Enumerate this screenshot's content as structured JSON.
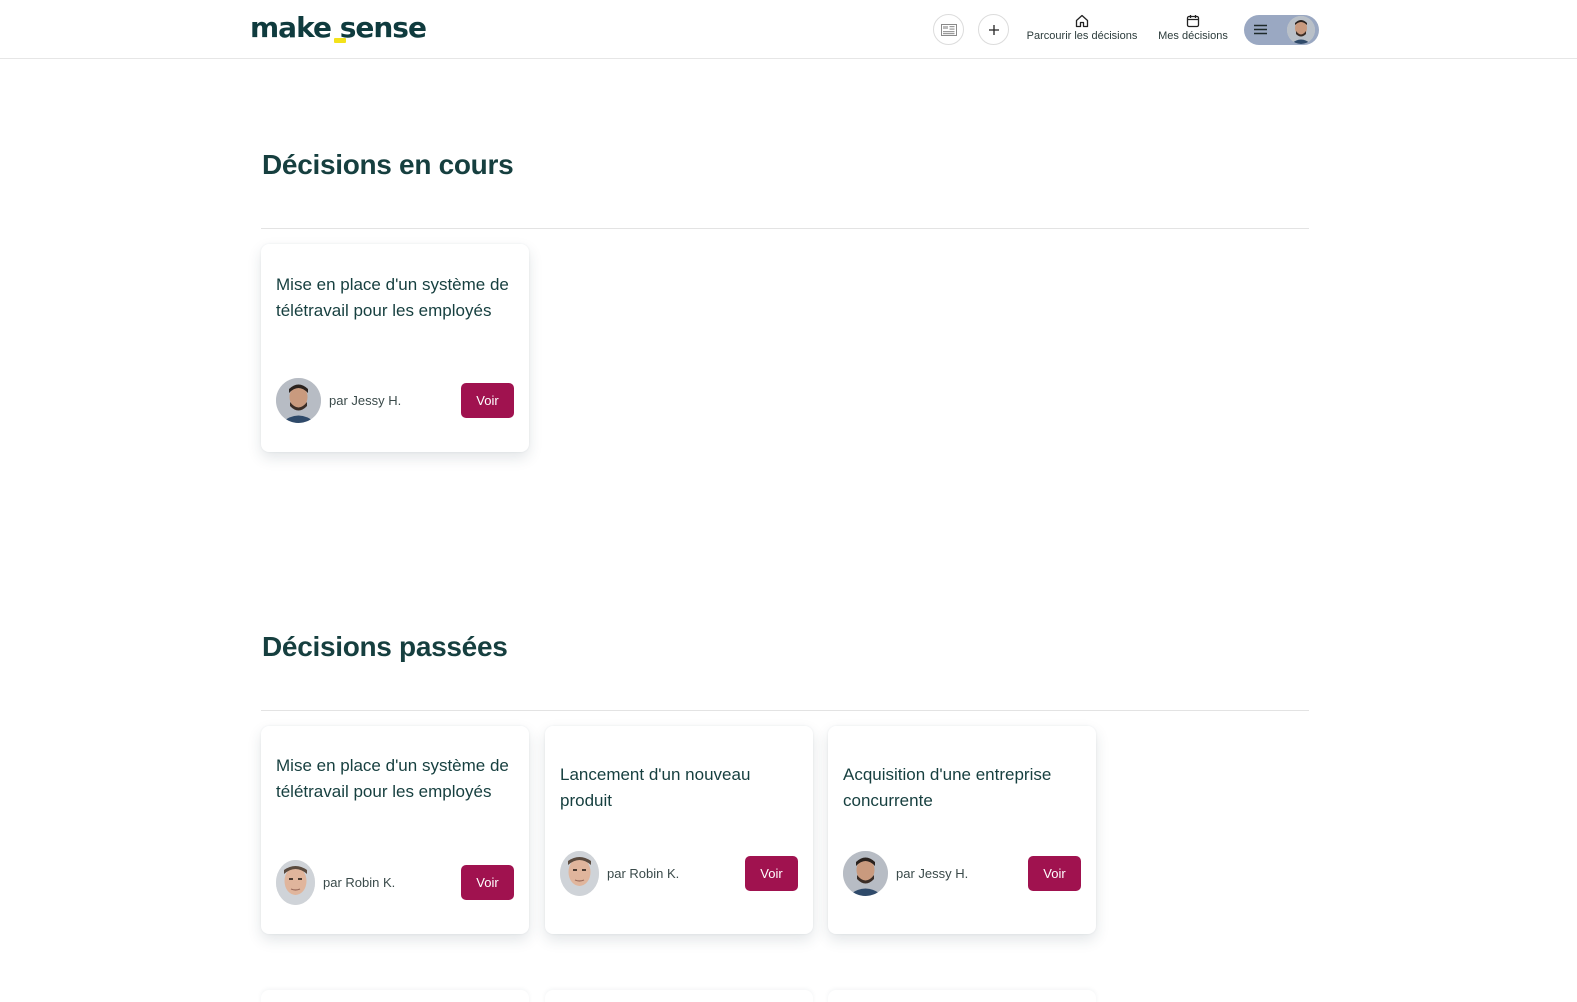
{
  "header": {
    "logo_part1": "make",
    "logo_part2": "sense",
    "browse_label": "Parcourir les décisions",
    "mine_label": "Mes décisions"
  },
  "icons": {
    "language": "language-icon",
    "add": "plus-icon",
    "home": "home-icon",
    "calendar": "calendar-icon",
    "menu": "hamburger-icon",
    "avatar": "user-avatar"
  },
  "colors": {
    "brand_dark": "#163f3f",
    "accent_button": "#a0124f",
    "logo_dot": "#f3e21b",
    "user_menu_bg": "#9aa8c2"
  },
  "sections": {
    "current_title": "Décisions en cours",
    "past_title": "Décisions passées"
  },
  "current_decisions": [
    {
      "title": "Mise en place d'un système de télétravail pour les employés",
      "author": "par Jessy H.",
      "button": "Voir"
    }
  ],
  "past_decisions": [
    {
      "title": "Mise en place d'un système de télétravail pour les employés",
      "author": "par Robin K.",
      "button": "Voir"
    },
    {
      "title": "Lancement d'un nouveau produit",
      "author": "par Robin K.",
      "button": "Voir"
    },
    {
      "title": "Acquisition d'une entreprise concurrente",
      "author": "par Jessy H.",
      "button": "Voir"
    }
  ]
}
